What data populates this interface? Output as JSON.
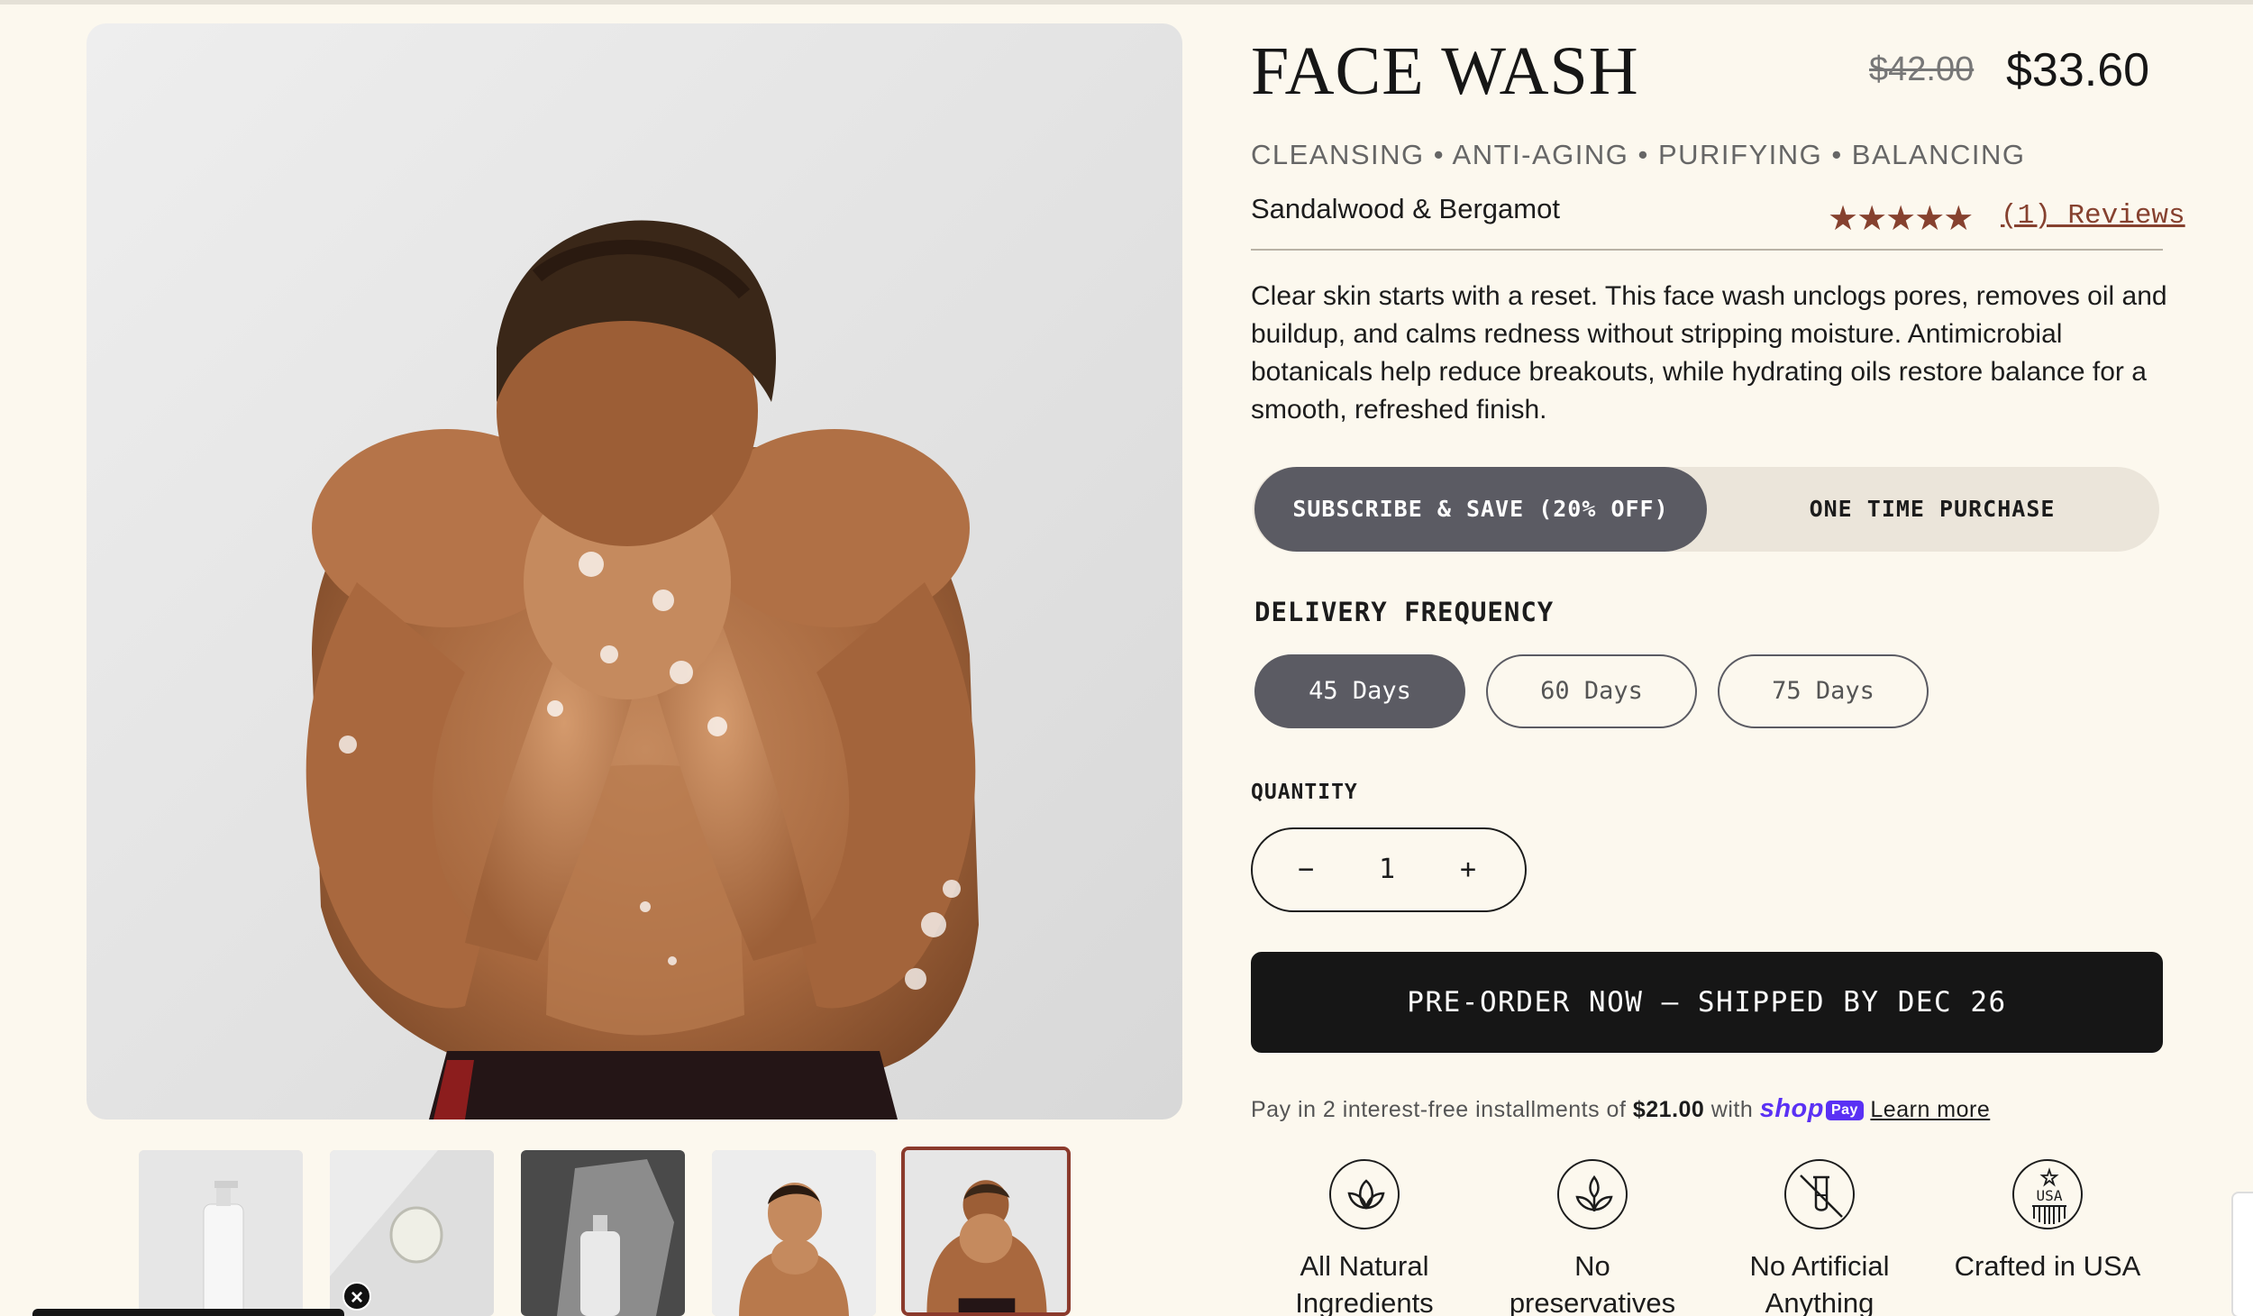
{
  "product": {
    "title": "FACE WASH",
    "price_original": "$42.00",
    "price_sale": "$33.60",
    "tags": "CLEANSING • ANTI-AGING • PURIFYING • BALANCING",
    "scent": "Sandalwood & Bergamot",
    "rating_stars": "★★★★★",
    "rating_value": 5,
    "reviews_link": "(1) Reviews",
    "description": "Clear skin starts with a reset. This face wash unclogs pores, removes oil and buildup, and calms redness without stripping moisture. Antimicrobial botanicals help reduce breakouts, while hydrating oils restore balance for a smooth, refreshed finish."
  },
  "purchase_options": {
    "subscribe_label": "SUBSCRIBE & SAVE (20% OFF)",
    "one_time_label": "ONE TIME PURCHASE",
    "selected": "subscribe"
  },
  "delivery": {
    "label": "DELIVERY FREQUENCY",
    "options": [
      "45 Days",
      "60 Days",
      "75 Days"
    ],
    "selected": "45 Days"
  },
  "quantity": {
    "label": "QUANTITY",
    "minus": "−",
    "value": "1",
    "plus": "+"
  },
  "cta": {
    "preorder_label": "PRE-ORDER NOW – SHIPPED BY DEC 26"
  },
  "installments": {
    "prefix": "Pay in 2 interest-free installments of",
    "amount": "$21.00",
    "with": "with",
    "shop": "shop",
    "pay": "Pay",
    "learn_more": "Learn more"
  },
  "features": [
    {
      "icon": "leaf-icon",
      "label_line1": "All Natural",
      "label_line2": "Ingredients"
    },
    {
      "icon": "plant-icon",
      "label_line1": "No",
      "label_line2": "preservatives"
    },
    {
      "icon": "test-tube-slash-icon",
      "label_line1": "No Artificial",
      "label_line2": "Anything"
    },
    {
      "icon": "usa-badge-icon",
      "label_line1": "Crafted in USA",
      "label_line2": ""
    }
  ],
  "usa_badge_text": "USA",
  "gallery": {
    "thumb_count": 5,
    "selected_index": 4
  },
  "colors": {
    "background": "#fcf8ee",
    "accent_brown": "#86412f",
    "toggle_active": "#5b5b63",
    "cta_black": "#161616",
    "shop_pay_purple": "#5a31f4"
  }
}
